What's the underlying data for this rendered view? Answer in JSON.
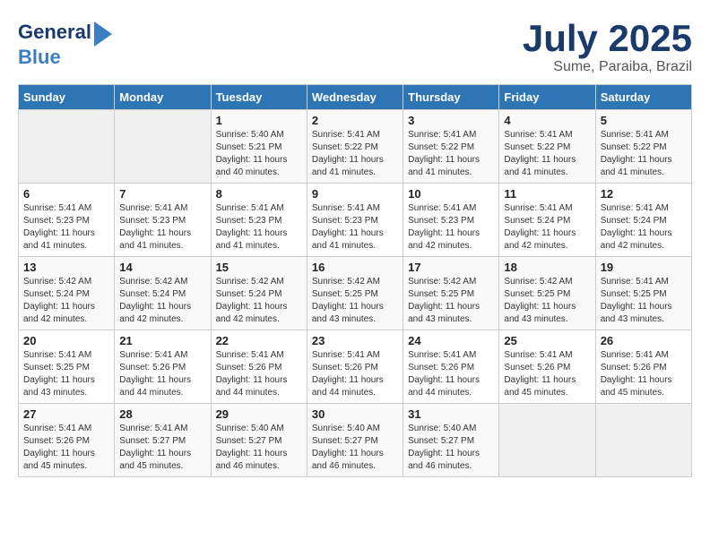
{
  "header": {
    "logo_line1": "General",
    "logo_line2": "Blue",
    "title": "July 2025",
    "subtitle": "Sume, Paraiba, Brazil"
  },
  "days_of_week": [
    "Sunday",
    "Monday",
    "Tuesday",
    "Wednesday",
    "Thursday",
    "Friday",
    "Saturday"
  ],
  "weeks": [
    [
      {
        "day": "",
        "detail": ""
      },
      {
        "day": "",
        "detail": ""
      },
      {
        "day": "1",
        "detail": "Sunrise: 5:40 AM\nSunset: 5:21 PM\nDaylight: 11 hours and 40 minutes."
      },
      {
        "day": "2",
        "detail": "Sunrise: 5:41 AM\nSunset: 5:22 PM\nDaylight: 11 hours and 41 minutes."
      },
      {
        "day": "3",
        "detail": "Sunrise: 5:41 AM\nSunset: 5:22 PM\nDaylight: 11 hours and 41 minutes."
      },
      {
        "day": "4",
        "detail": "Sunrise: 5:41 AM\nSunset: 5:22 PM\nDaylight: 11 hours and 41 minutes."
      },
      {
        "day": "5",
        "detail": "Sunrise: 5:41 AM\nSunset: 5:22 PM\nDaylight: 11 hours and 41 minutes."
      }
    ],
    [
      {
        "day": "6",
        "detail": "Sunrise: 5:41 AM\nSunset: 5:23 PM\nDaylight: 11 hours and 41 minutes."
      },
      {
        "day": "7",
        "detail": "Sunrise: 5:41 AM\nSunset: 5:23 PM\nDaylight: 11 hours and 41 minutes."
      },
      {
        "day": "8",
        "detail": "Sunrise: 5:41 AM\nSunset: 5:23 PM\nDaylight: 11 hours and 41 minutes."
      },
      {
        "day": "9",
        "detail": "Sunrise: 5:41 AM\nSunset: 5:23 PM\nDaylight: 11 hours and 41 minutes."
      },
      {
        "day": "10",
        "detail": "Sunrise: 5:41 AM\nSunset: 5:23 PM\nDaylight: 11 hours and 42 minutes."
      },
      {
        "day": "11",
        "detail": "Sunrise: 5:41 AM\nSunset: 5:24 PM\nDaylight: 11 hours and 42 minutes."
      },
      {
        "day": "12",
        "detail": "Sunrise: 5:41 AM\nSunset: 5:24 PM\nDaylight: 11 hours and 42 minutes."
      }
    ],
    [
      {
        "day": "13",
        "detail": "Sunrise: 5:42 AM\nSunset: 5:24 PM\nDaylight: 11 hours and 42 minutes."
      },
      {
        "day": "14",
        "detail": "Sunrise: 5:42 AM\nSunset: 5:24 PM\nDaylight: 11 hours and 42 minutes."
      },
      {
        "day": "15",
        "detail": "Sunrise: 5:42 AM\nSunset: 5:24 PM\nDaylight: 11 hours and 42 minutes."
      },
      {
        "day": "16",
        "detail": "Sunrise: 5:42 AM\nSunset: 5:25 PM\nDaylight: 11 hours and 43 minutes."
      },
      {
        "day": "17",
        "detail": "Sunrise: 5:42 AM\nSunset: 5:25 PM\nDaylight: 11 hours and 43 minutes."
      },
      {
        "day": "18",
        "detail": "Sunrise: 5:42 AM\nSunset: 5:25 PM\nDaylight: 11 hours and 43 minutes."
      },
      {
        "day": "19",
        "detail": "Sunrise: 5:41 AM\nSunset: 5:25 PM\nDaylight: 11 hours and 43 minutes."
      }
    ],
    [
      {
        "day": "20",
        "detail": "Sunrise: 5:41 AM\nSunset: 5:25 PM\nDaylight: 11 hours and 43 minutes."
      },
      {
        "day": "21",
        "detail": "Sunrise: 5:41 AM\nSunset: 5:26 PM\nDaylight: 11 hours and 44 minutes."
      },
      {
        "day": "22",
        "detail": "Sunrise: 5:41 AM\nSunset: 5:26 PM\nDaylight: 11 hours and 44 minutes."
      },
      {
        "day": "23",
        "detail": "Sunrise: 5:41 AM\nSunset: 5:26 PM\nDaylight: 11 hours and 44 minutes."
      },
      {
        "day": "24",
        "detail": "Sunrise: 5:41 AM\nSunset: 5:26 PM\nDaylight: 11 hours and 44 minutes."
      },
      {
        "day": "25",
        "detail": "Sunrise: 5:41 AM\nSunset: 5:26 PM\nDaylight: 11 hours and 45 minutes."
      },
      {
        "day": "26",
        "detail": "Sunrise: 5:41 AM\nSunset: 5:26 PM\nDaylight: 11 hours and 45 minutes."
      }
    ],
    [
      {
        "day": "27",
        "detail": "Sunrise: 5:41 AM\nSunset: 5:26 PM\nDaylight: 11 hours and 45 minutes."
      },
      {
        "day": "28",
        "detail": "Sunrise: 5:41 AM\nSunset: 5:27 PM\nDaylight: 11 hours and 45 minutes."
      },
      {
        "day": "29",
        "detail": "Sunrise: 5:40 AM\nSunset: 5:27 PM\nDaylight: 11 hours and 46 minutes."
      },
      {
        "day": "30",
        "detail": "Sunrise: 5:40 AM\nSunset: 5:27 PM\nDaylight: 11 hours and 46 minutes."
      },
      {
        "day": "31",
        "detail": "Sunrise: 5:40 AM\nSunset: 5:27 PM\nDaylight: 11 hours and 46 minutes."
      },
      {
        "day": "",
        "detail": ""
      },
      {
        "day": "",
        "detail": ""
      }
    ]
  ]
}
